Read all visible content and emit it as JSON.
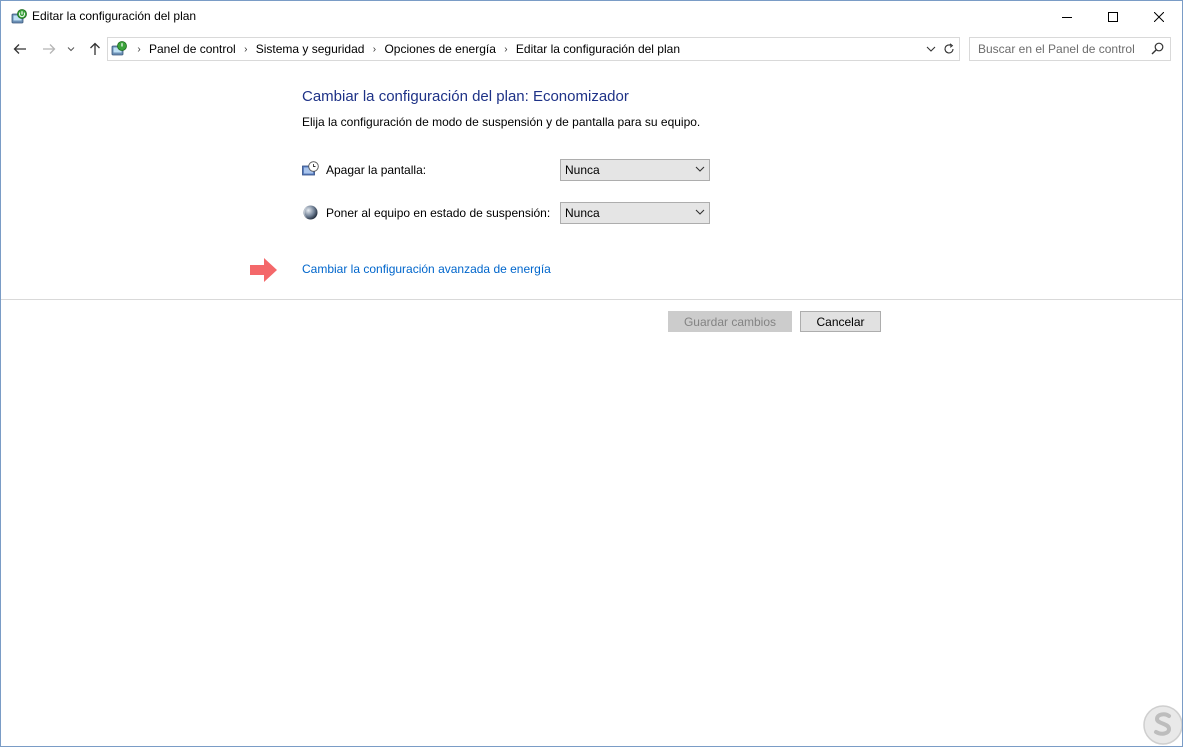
{
  "window": {
    "title": "Editar la configuración del plan"
  },
  "nav": {
    "breadcrumbs": [
      "Panel de control",
      "Sistema y seguridad",
      "Opciones de energía",
      "Editar la configuración del plan"
    ],
    "search_placeholder": "Buscar en el Panel de control"
  },
  "content": {
    "title": "Cambiar la configuración del plan: Economizador",
    "subtitle": "Elija la configuración de modo de suspensión y de pantalla para su equipo.",
    "settings": [
      {
        "label": "Apagar la pantalla:",
        "value": "Nunca",
        "icon": "monitor-clock-icon"
      },
      {
        "label": "Poner al equipo en estado de suspensión:",
        "value": "Nunca",
        "icon": "moon-icon"
      }
    ],
    "advanced_link": "Cambiar la configuración avanzada de energía"
  },
  "buttons": {
    "save_label": "Guardar cambios",
    "save_enabled": false,
    "cancel_label": "Cancelar"
  },
  "colors": {
    "title_blue": "#1e3287",
    "link_blue": "#0066cc",
    "arrow_annotation": "#f4686a"
  }
}
